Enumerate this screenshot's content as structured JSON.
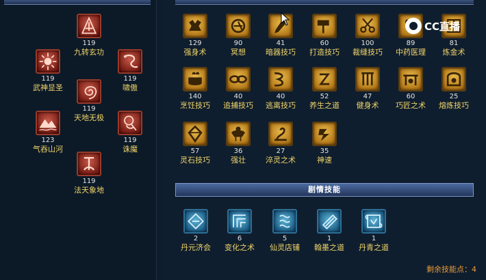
{
  "watermark": {
    "text": "CC直播"
  },
  "martial_skills": [
    {
      "level": "119",
      "name": "九转玄功",
      "icon": "tornado-rune-icon"
    },
    {
      "level": "119",
      "name": "武神显圣",
      "icon": "sunburst-icon"
    },
    {
      "level": "119",
      "name": "啸傲",
      "icon": "dragon-icon"
    },
    {
      "level": "119",
      "name": "天地无极",
      "icon": "vortex-icon"
    },
    {
      "level": "123",
      "name": "气吞山河",
      "icon": "mountain-wave-icon"
    },
    {
      "level": "119",
      "name": "诛魔",
      "icon": "demon-slayer-icon"
    },
    {
      "level": "119",
      "name": "法天象地",
      "icon": "heaven-symbol-icon"
    }
  ],
  "life_skills": [
    {
      "level": "129",
      "name": "强身术",
      "icon": "strong-body-icon"
    },
    {
      "level": "90",
      "name": "冥想",
      "icon": "meditation-icon"
    },
    {
      "level": "41",
      "name": "暗器技巧",
      "icon": "dart-icon"
    },
    {
      "level": "60",
      "name": "打造技巧",
      "icon": "hammer-icon"
    },
    {
      "level": "100",
      "name": "裁缝技巧",
      "icon": "scissors-icon"
    },
    {
      "level": "89",
      "name": "中药医理",
      "icon": "herb-icon"
    },
    {
      "level": "81",
      "name": "炼金术",
      "icon": "alchemy-icon"
    },
    {
      "level": "140",
      "name": "烹饪技巧",
      "icon": "cooking-pot-icon"
    },
    {
      "level": "40",
      "name": "追捕技巧",
      "icon": "chain-icon"
    },
    {
      "level": "40",
      "name": "逃离技巧",
      "icon": "escape-icon"
    },
    {
      "level": "52",
      "name": "养生之道",
      "icon": "health-icon"
    },
    {
      "level": "47",
      "name": "健身术",
      "icon": "fitness-icon"
    },
    {
      "level": "60",
      "name": "巧匠之术",
      "icon": "craftsman-icon"
    },
    {
      "level": "25",
      "name": "熔炼技巧",
      "icon": "furnace-icon"
    },
    {
      "level": "57",
      "name": "灵石技巧",
      "icon": "spirit-stone-icon"
    },
    {
      "level": "36",
      "name": "强壮",
      "icon": "muscle-icon"
    },
    {
      "level": "27",
      "name": "淬灵之术",
      "icon": "quench-icon"
    },
    {
      "level": "35",
      "name": "神速",
      "icon": "speed-icon"
    }
  ],
  "story_section": {
    "title": "剧情技能"
  },
  "story_skills": [
    {
      "level": "2",
      "name": "丹元济会",
      "icon": "elixir-icon"
    },
    {
      "level": "6",
      "name": "变化之术",
      "icon": "transform-icon"
    },
    {
      "level": "5",
      "name": "仙灵店铺",
      "icon": "fairy-shop-icon"
    },
    {
      "level": "1",
      "name": "翰墨之道",
      "icon": "ink-brush-icon"
    },
    {
      "level": "1",
      "name": "丹青之道",
      "icon": "painting-scroll-icon"
    }
  ],
  "remaining_points": {
    "label": "剩余技能点：4"
  },
  "colors": {
    "background": "#0e1c2b",
    "skill_name": "#f0d46a",
    "remaining": "#e89a3a"
  }
}
